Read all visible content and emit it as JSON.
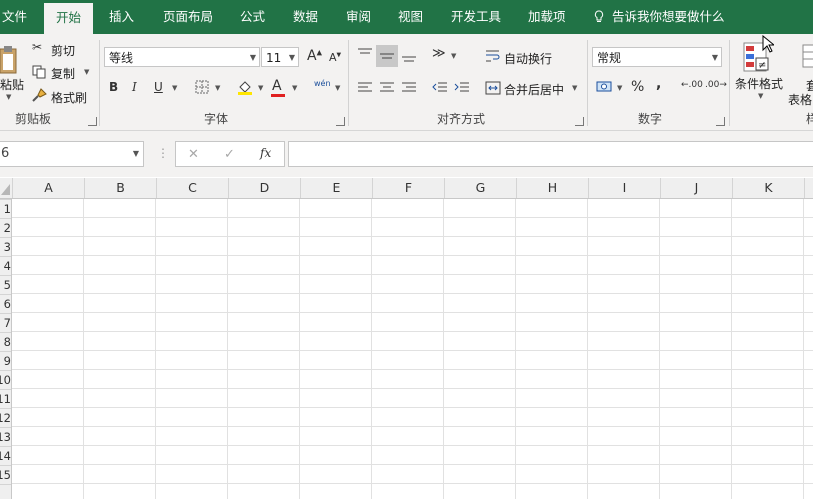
{
  "tabs": [
    {
      "label": "文件",
      "active": false
    },
    {
      "label": "开始",
      "active": true
    },
    {
      "label": "插入",
      "active": false
    },
    {
      "label": "页面布局",
      "active": false
    },
    {
      "label": "公式",
      "active": false
    },
    {
      "label": "数据",
      "active": false
    },
    {
      "label": "审阅",
      "active": false
    },
    {
      "label": "视图",
      "active": false
    },
    {
      "label": "开发工具",
      "active": false
    },
    {
      "label": "加载项",
      "active": false
    }
  ],
  "tellme": "告诉我你想要做什么",
  "clipboard": {
    "paste": "贴",
    "paste_label": "粘贴",
    "cut": "剪切",
    "copy": "复制",
    "format_painter": "格式刷",
    "group": "剪贴板"
  },
  "font": {
    "name": "等线",
    "size": "11",
    "group": "字体",
    "grow": "A",
    "shrink": "A",
    "bold": "B",
    "italic": "I",
    "underline": "U",
    "font_color": "A",
    "wen": "wén"
  },
  "alignment": {
    "wrap": "自动换行",
    "merge": "合并后居中",
    "group": "对齐方式"
  },
  "number": {
    "format": "常规",
    "percent": "%",
    "comma": ",",
    "inc_dec": ".00",
    "group": "数字"
  },
  "styles": {
    "conditional": "条件格式",
    "table_format": "套用表格格式",
    "table_top": "套",
    "table_bottom": "表格"
  },
  "formula_bar": {
    "name_box": "6",
    "fx": "fx",
    "cancel": "✕",
    "enter": "✓",
    "value": ""
  },
  "grid": {
    "columns": [
      "A",
      "B",
      "C",
      "D",
      "E",
      "F",
      "G",
      "H",
      "I",
      "J",
      "K"
    ],
    "rows": [
      "1",
      "2",
      "3",
      "4",
      "5",
      "6",
      "7",
      "8",
      "9",
      "10",
      "11",
      "12",
      "13",
      "14",
      "15"
    ]
  },
  "colors": {
    "accent": "#217346",
    "ribbon_bg": "#f3f2f1",
    "header_bg": "#efefef"
  }
}
